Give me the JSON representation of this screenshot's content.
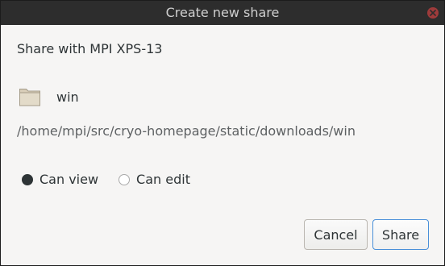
{
  "window": {
    "title": "Create new share"
  },
  "dialog": {
    "share_with": "Share with MPI XPS-13",
    "folder": {
      "icon": "folder-icon",
      "name": "win"
    },
    "path": "/home/mpi/src/cryo-homepage/static/downloads/win",
    "permissions": {
      "selected": "Can view",
      "options": [
        "Can view",
        "Can edit"
      ]
    },
    "buttons": {
      "cancel": "Cancel",
      "share": "Share"
    }
  },
  "colors": {
    "titlebar_bg": "#2d2d2d",
    "close_button": "#9e3b3b",
    "window_bg": "#f6f5f4",
    "default_button_border": "#4a90d9"
  }
}
